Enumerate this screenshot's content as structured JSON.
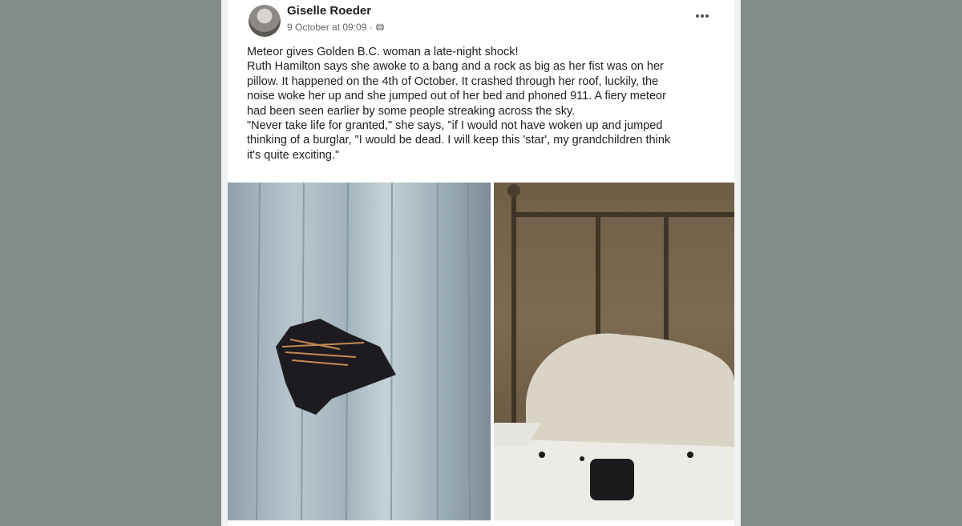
{
  "post": {
    "author": "Giselle Roeder",
    "timestamp": "9 October at 09:09 ·",
    "lines": [
      "Meteor gives Golden B.C. woman a late-night shock!",
      "Ruth Hamilton says she awoke to a bang and a rock as big as her fist was on her",
      "pillow. It happened on the 4th of October. It crashed through her roof, luckily, the",
      "noise woke her up and she jumped out of her bed and phoned 911. A fiery meteor",
      "had been seen earlier by some people streaking across the sky.",
      "\"Never take life for granted,\" she says, \"if I would not have woken up and jumped",
      "thinking of a burglar, \"I would be dead. I will keep this 'star', my grandchildren think",
      "it's quite exciting.\""
    ],
    "icons": {
      "audience": "globe-icon",
      "menu": "more-options-icon"
    }
  },
  "colors": {
    "background": "#848c8a",
    "text": "#1c1e21",
    "secondary": "#65676b"
  }
}
